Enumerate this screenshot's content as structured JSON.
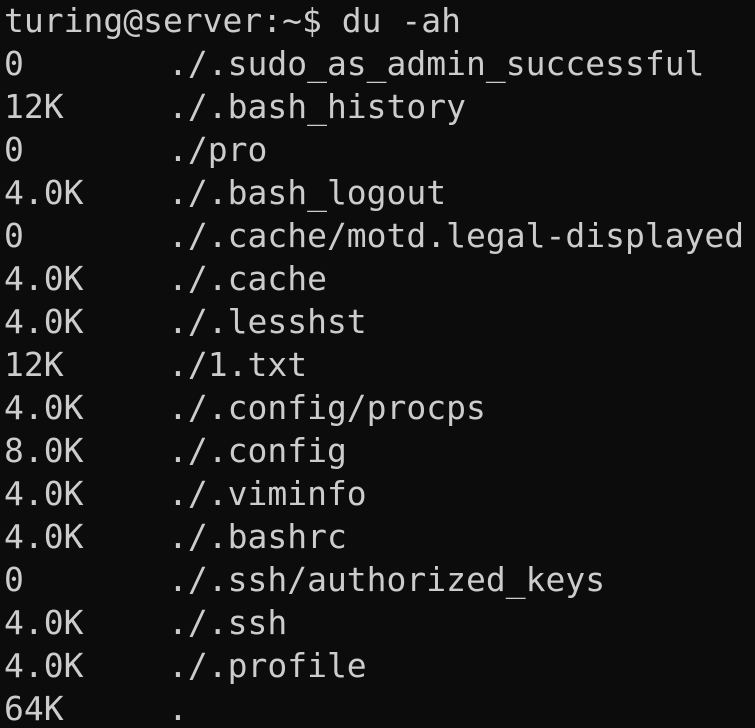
{
  "terminal": {
    "prompt": "turing@server:~$ ",
    "command": "du -ah",
    "rows": [
      {
        "size": "0",
        "path": "./.sudo_as_admin_successful"
      },
      {
        "size": "12K",
        "path": "./.bash_history"
      },
      {
        "size": "0",
        "path": "./pro"
      },
      {
        "size": "4.0K",
        "path": "./.bash_logout"
      },
      {
        "size": "0",
        "path": "./.cache/motd.legal-displayed"
      },
      {
        "size": "4.0K",
        "path": "./.cache"
      },
      {
        "size": "4.0K",
        "path": "./.lesshst"
      },
      {
        "size": "12K",
        "path": "./1.txt"
      },
      {
        "size": "4.0K",
        "path": "./.config/procps"
      },
      {
        "size": "8.0K",
        "path": "./.config"
      },
      {
        "size": "4.0K",
        "path": "./.viminfo"
      },
      {
        "size": "4.0K",
        "path": "./.bashrc"
      },
      {
        "size": "0",
        "path": "./.ssh/authorized_keys"
      },
      {
        "size": "4.0K",
        "path": "./.ssh"
      },
      {
        "size": "4.0K",
        "path": "./.profile"
      },
      {
        "size": "64K",
        "path": "."
      }
    ]
  },
  "colors": {
    "background": "#0c0c0c",
    "foreground": "#cccccc"
  }
}
